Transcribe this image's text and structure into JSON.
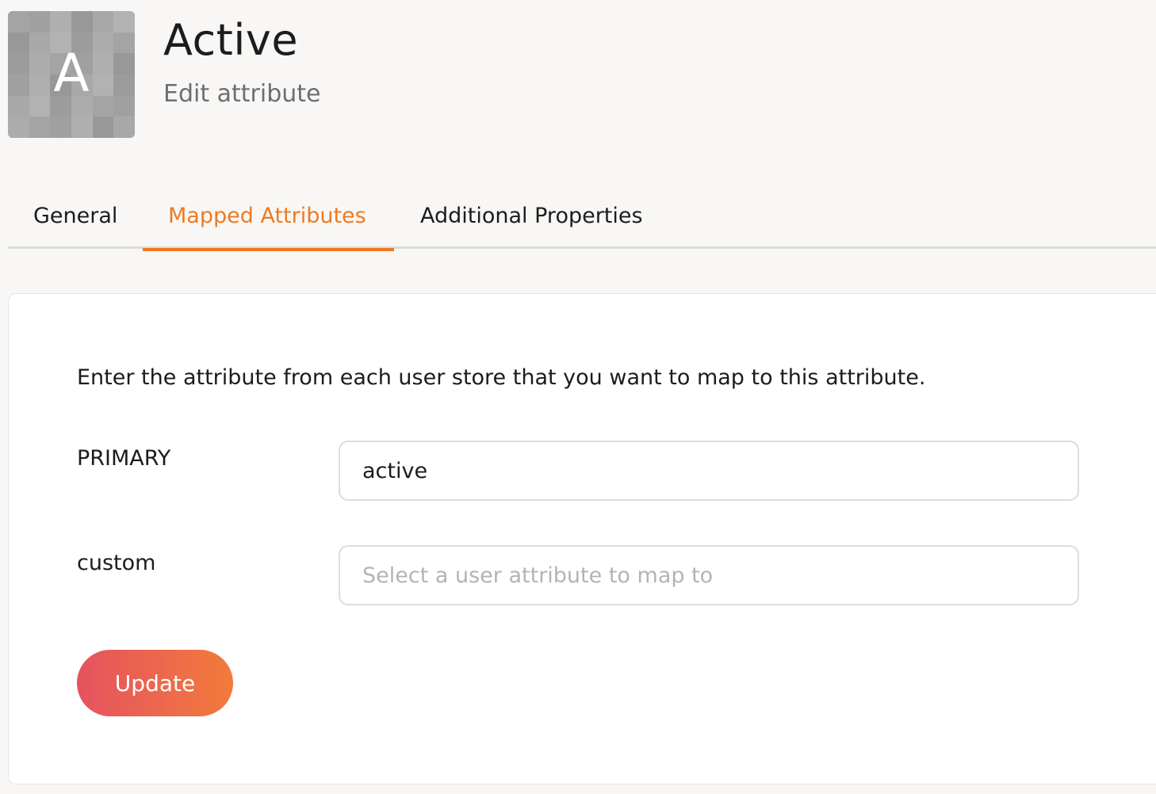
{
  "header": {
    "avatar_letter": "A",
    "title": "Active",
    "subtitle": "Edit attribute"
  },
  "tabs": [
    {
      "label": "General",
      "active": false
    },
    {
      "label": "Mapped Attributes",
      "active": true
    },
    {
      "label": "Additional Properties",
      "active": false
    }
  ],
  "form": {
    "description": "Enter the attribute from each user store that you want to map to this attribute.",
    "rows": [
      {
        "label": "PRIMARY",
        "value": "active",
        "placeholder": ""
      },
      {
        "label": "custom",
        "value": "",
        "placeholder": "Select a user attribute to map to"
      }
    ],
    "update_label": "Update"
  },
  "colors": {
    "accent": "#ef7a1f",
    "button_gradient_start": "#e6525f",
    "button_gradient_end": "#f27b3c"
  }
}
